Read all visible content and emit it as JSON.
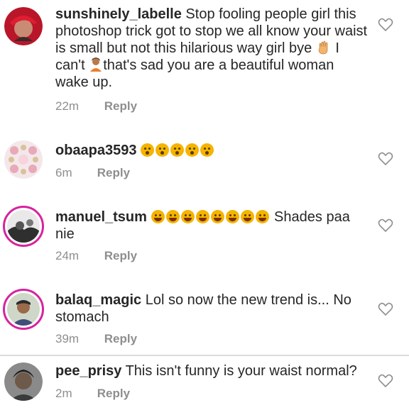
{
  "comments": [
    {
      "username": "sunshinely_labelle",
      "text_parts": [
        "Stop fooling people girl this photoshop trick got to stop we all know your waist is small but not this hilarious way girl bye ",
        " I can't ",
        "that's sad you are a beautiful woman wake up."
      ],
      "time": "22m",
      "reply": "Reply"
    },
    {
      "username": "obaapa3593",
      "text": "",
      "time": "6m",
      "reply": "Reply"
    },
    {
      "username": "manuel_tsum",
      "text": " Shades paa nie",
      "time": "24m",
      "reply": "Reply"
    },
    {
      "username": "balaq_magic",
      "text": "Lol so now the new trend is... No stomach",
      "time": "39m",
      "reply": "Reply"
    },
    {
      "username": "pee_prisy",
      "text": "This isn't funny is your waist normal?",
      "time": "2m",
      "reply": "Reply"
    }
  ],
  "icons": {
    "like": "heart-outline-icon",
    "wave": "waving-hand-emoji",
    "shrug": "woman-gesturing-emoji",
    "wow": "hushed-face-emoji",
    "laugh": "rolling-laughing-emoji"
  },
  "colors": {
    "story_ring": "#d6249f",
    "meta_gray": "#8e8e8e",
    "text": "#262626"
  }
}
